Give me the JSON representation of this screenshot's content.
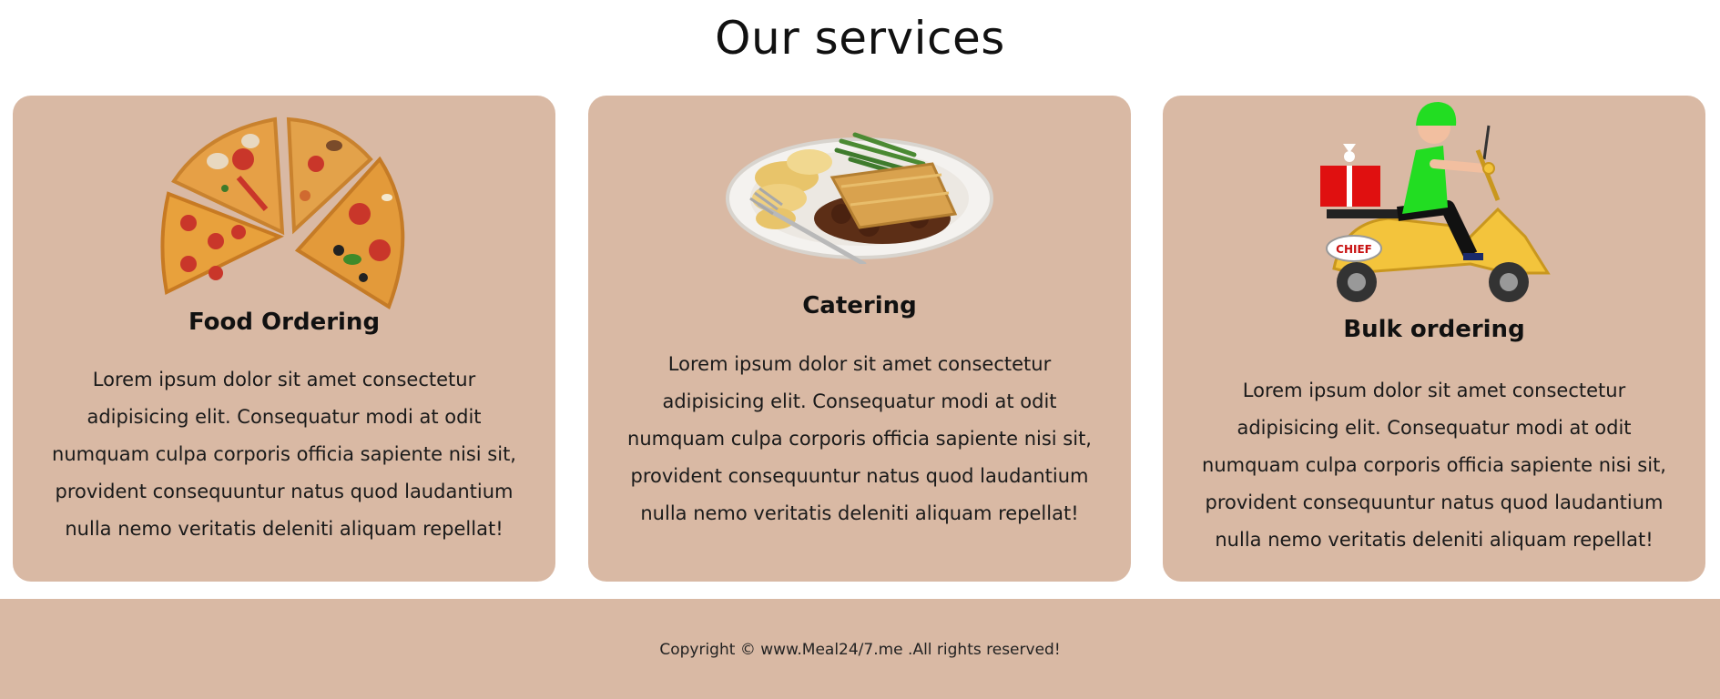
{
  "page": {
    "title": "Our services"
  },
  "services": [
    {
      "title": "Food Ordering",
      "description": "Lorem ipsum dolor sit amet consectetur adipisicing elit. Consequatur modi at odit numquam culpa corporis officia sapiente nisi sit, provident consequuntur natus quod laudantium nulla nemo veritatis deleniti aliquam repellat!",
      "image": "pizza-image"
    },
    {
      "title": "Catering",
      "description": "Lorem ipsum dolor sit amet consectetur adipisicing elit. Consequatur modi at odit numquam culpa corporis officia sapiente nisi sit, provident consequuntur natus quod laudantium nulla nemo veritatis deleniti aliquam repellat!",
      "image": "catering-plate-image"
    },
    {
      "title": "Bulk ordering",
      "description": "Lorem ipsum dolor sit amet consectetur adipisicing elit. Consequatur modi at odit numquam culpa corporis officia sapiente nisi sit, provident consequuntur natus quod laudantium nulla nemo veritatis deleniti aliquam repellat!",
      "image": "delivery-scooter-image"
    }
  ],
  "footer": {
    "copyright": "Copyright © www.Meal24/7.me .All rights reserved!"
  },
  "colors": {
    "card_background": "#d9b9a4",
    "footer_background": "#d9b9a4",
    "page_background": "#ffffff"
  }
}
